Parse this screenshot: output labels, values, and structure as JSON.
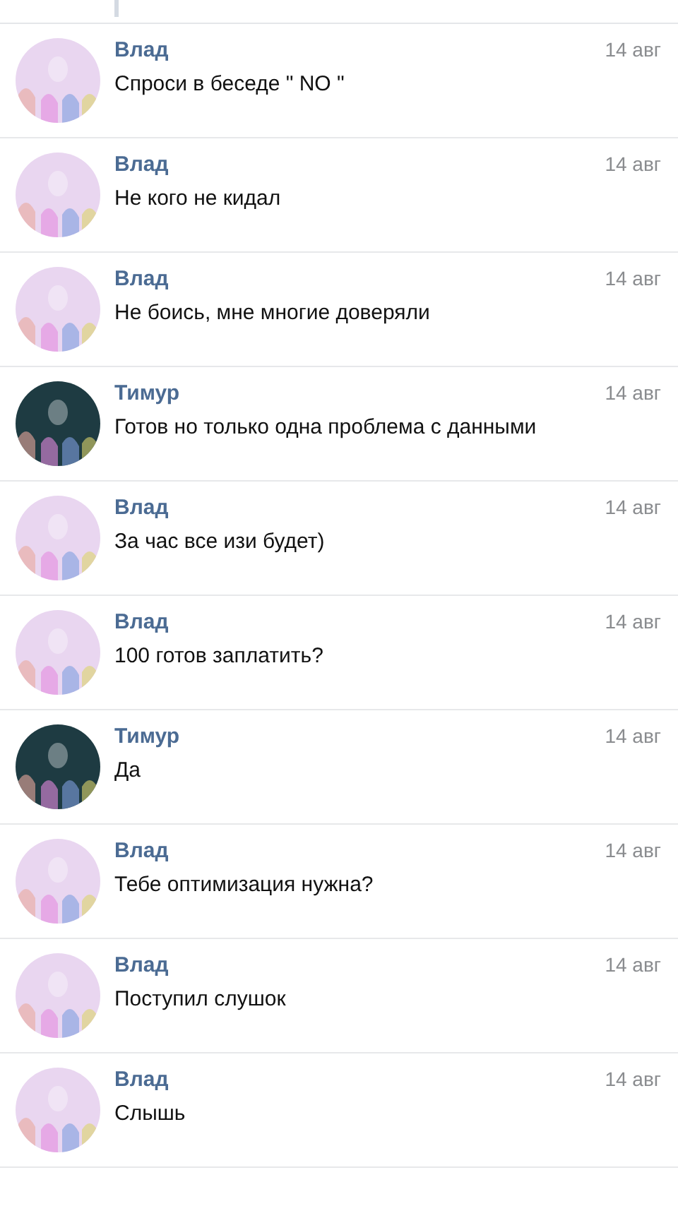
{
  "messages": [
    {
      "sender": "Влад",
      "text": "Спроси в беседе \" NO \"",
      "date": "14 авг",
      "color": "#e9d6f0"
    },
    {
      "sender": "Влад",
      "text": "Не кого не кидал",
      "date": "14 авг",
      "color": "#e9d6f0"
    },
    {
      "sender": "Влад",
      "text": "Не боись, мне многие доверяли",
      "date": "14 авг",
      "color": "#e9d6f0"
    },
    {
      "sender": "Тимур",
      "text": "Готов но только одна проблема с данными",
      "date": "14 авг",
      "color": "#1e3b42"
    },
    {
      "sender": "Влад",
      "text": "За час все изи будет)",
      "date": "14 авг",
      "color": "#e9d6f0"
    },
    {
      "sender": "Влад",
      "text": "100 готов заплатить?",
      "date": "14 авг",
      "color": "#e9d6f0"
    },
    {
      "sender": "Тимур",
      "text": "Да",
      "date": "14 авг",
      "color": "#1e3b42"
    },
    {
      "sender": "Влад",
      "text": "Тебе оптимизация нужна?",
      "date": "14 авг",
      "color": "#e9d6f0"
    },
    {
      "sender": "Влад",
      "text": "Поступил слушок",
      "date": "14 авг",
      "color": "#e9d6f0"
    },
    {
      "sender": "Влад",
      "text": "Слышь",
      "date": "14 авг",
      "color": "#e9d6f0"
    }
  ]
}
